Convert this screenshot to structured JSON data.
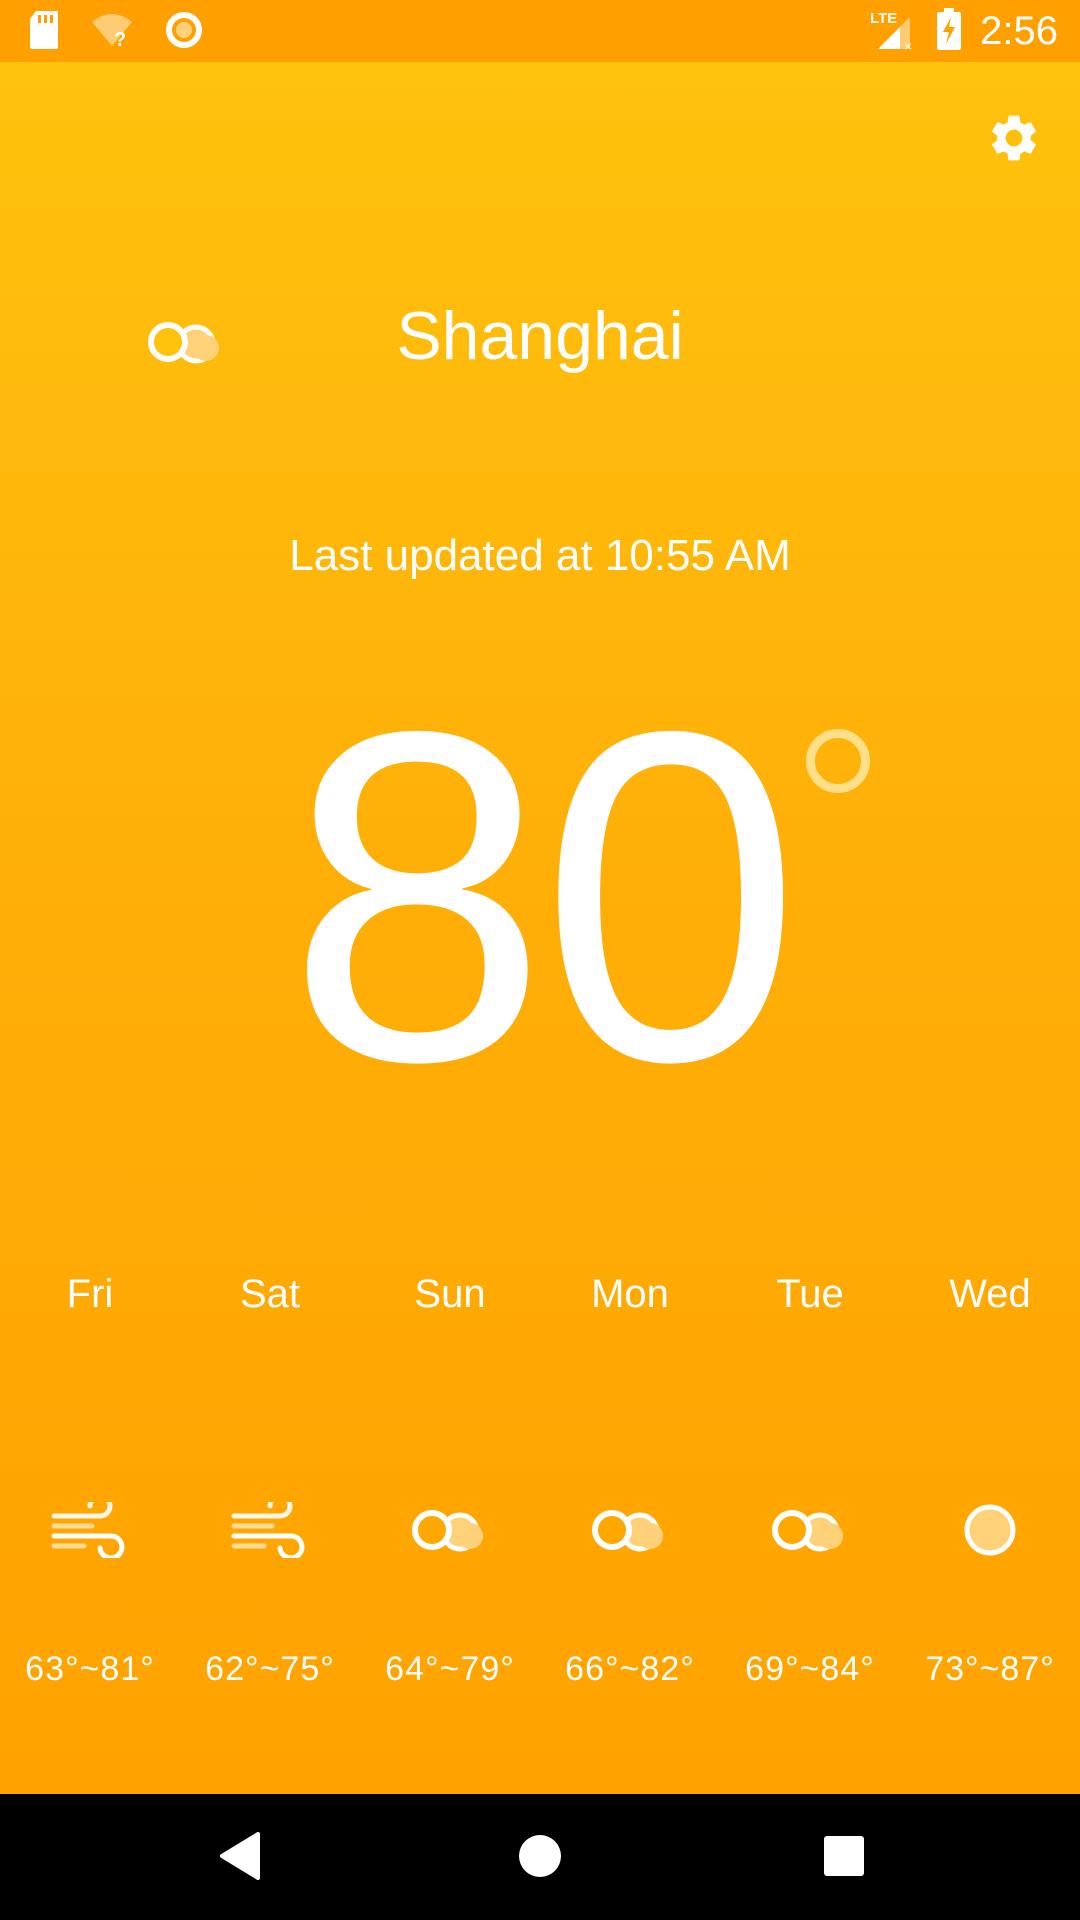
{
  "status_bar": {
    "time": "2:56",
    "icons": [
      "sd-card-icon",
      "wifi-question-icon",
      "ring-icon",
      "lte-signal-icon",
      "battery-charging-icon"
    ]
  },
  "app": {
    "settings_icon": "gear-icon",
    "current_icon": "cloudy-icon",
    "city": "Shanghai",
    "last_updated": "Last updated at 10:55 AM",
    "temperature": "80",
    "degree_icon": "degree-ring-icon"
  },
  "forecast": [
    {
      "day": "Fri",
      "icon": "wind-icon",
      "range": "63°~81°"
    },
    {
      "day": "Sat",
      "icon": "wind-icon",
      "range": "62°~75°"
    },
    {
      "day": "Sun",
      "icon": "cloudy-icon",
      "range": "64°~79°"
    },
    {
      "day": "Mon",
      "icon": "cloudy-icon",
      "range": "66°~82°"
    },
    {
      "day": "Tue",
      "icon": "cloudy-icon",
      "range": "69°~84°"
    },
    {
      "day": "Wed",
      "icon": "sun-icon",
      "range": "73°~87°"
    }
  ],
  "nav_bar": {
    "buttons": [
      "back-icon",
      "home-icon",
      "recents-icon"
    ]
  },
  "colors": {
    "status_bar": "#ffa000",
    "gradient_top": "#ffc20d",
    "gradient_bottom": "#ffa200",
    "icon_light": "#ffe089",
    "nav_bar": "#000000"
  }
}
